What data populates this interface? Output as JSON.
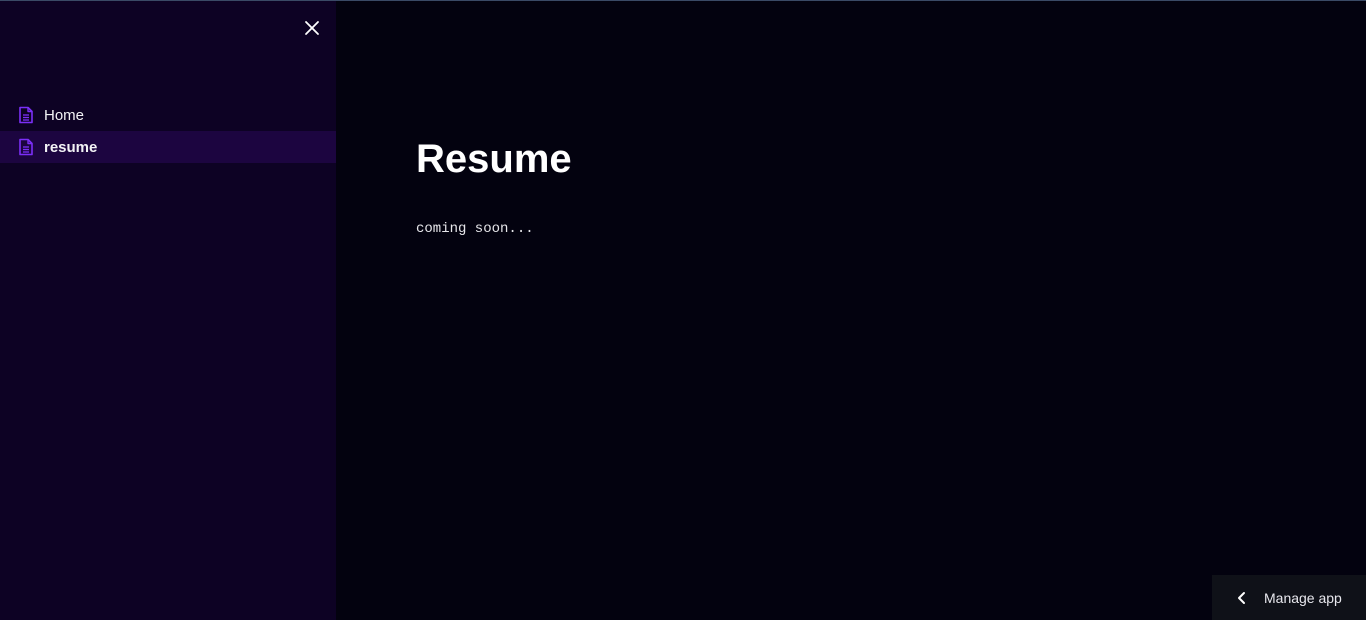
{
  "sidebar": {
    "close_icon": "close-icon",
    "items": [
      {
        "label": "Home",
        "icon": "document-icon",
        "active": false
      },
      {
        "label": "resume",
        "icon": "document-icon",
        "active": true
      }
    ]
  },
  "main": {
    "title": "Resume",
    "body": "coming soon..."
  },
  "footer": {
    "manage_app_label": "Manage app",
    "manage_app_icon": "chevron-left-icon"
  },
  "colors": {
    "background": "#03020f",
    "sidebar": "#0d0224",
    "active_item": "#1c0540",
    "accent": "#7b2ff7"
  }
}
